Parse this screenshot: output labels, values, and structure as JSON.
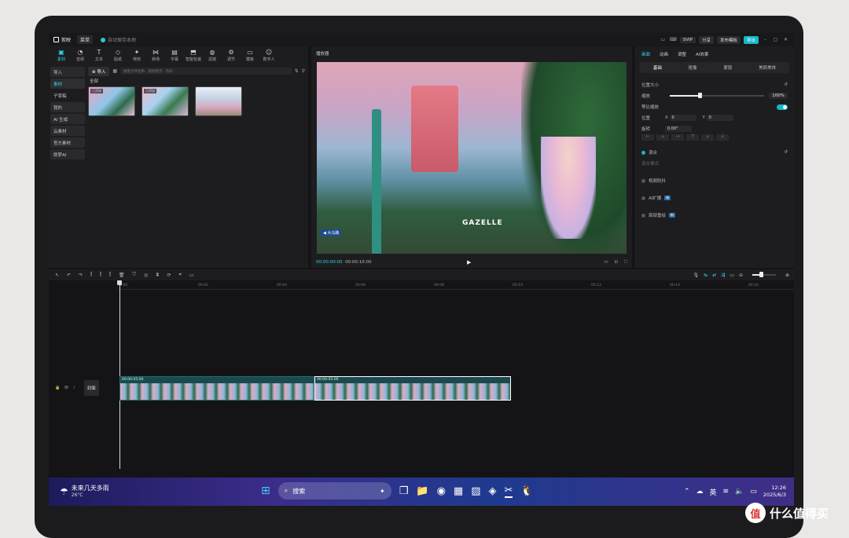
{
  "titlebar": {
    "app_name": "剪映",
    "menu": "菜单",
    "autosave": "自动保存本地",
    "svip": "SVIP",
    "share": "分享",
    "publish": "发布模板",
    "export": "导出"
  },
  "toolbar": {
    "tools": [
      {
        "label": "素材",
        "icon": "media-icon"
      },
      {
        "label": "音频",
        "icon": "audio-icon"
      },
      {
        "label": "文本",
        "icon": "text-icon"
      },
      {
        "label": "贴纸",
        "icon": "sticker-icon"
      },
      {
        "label": "特效",
        "icon": "effect-icon"
      },
      {
        "label": "转场",
        "icon": "transition-icon"
      },
      {
        "label": "字幕",
        "icon": "subtitle-icon"
      },
      {
        "label": "智能包装",
        "icon": "package-icon"
      },
      {
        "label": "滤镜",
        "icon": "filter-icon"
      },
      {
        "label": "调节",
        "icon": "adjust-icon"
      },
      {
        "label": "模板",
        "icon": "template-icon"
      },
      {
        "label": "数字人",
        "icon": "avatar-icon"
      }
    ]
  },
  "sidebar": {
    "items": [
      "导入",
      "素材",
      "子草稿",
      "我的",
      "AI 生成",
      "云素材",
      "官方素材",
      "即梦AI"
    ]
  },
  "media": {
    "import": "导入",
    "search_placeholder": "搜索文件名称、链接提示、色彩",
    "all": "全部",
    "thumbs": [
      {
        "tag": "已添加"
      },
      {
        "tag": "已添加"
      },
      {
        "tag": ""
      }
    ]
  },
  "player": {
    "title": "播放器",
    "timecode": "00:00:00:00",
    "duration": "00:00:10:00",
    "sign": "◀ 大马路",
    "logo": "GAZELLE"
  },
  "props": {
    "tabs": [
      "画面",
      "动画",
      "调整",
      "AI效果"
    ],
    "subtabs": [
      "基础",
      "抠像",
      "蒙版",
      "美颜美体"
    ],
    "pos_size": "位置大小",
    "scale": "缩放",
    "scale_val": "100%",
    "ratio": "等比缩放",
    "position": "位置",
    "x_label": "X",
    "x_val": "0",
    "y_label": "Y",
    "y_val": "0",
    "rotate": "旋转",
    "rotate_val": "0.00°",
    "mix": "混合",
    "mix_mode": "混合模式",
    "stabilize": "视频防抖",
    "ai_expand": "AI扩展",
    "ai_badge": "新",
    "local_redraw": "局部重绘",
    "redraw_badge": "新"
  },
  "timeline": {
    "ruler": [
      "0:00",
      "00:02",
      "00:04",
      "00:06",
      "00:08",
      "00:10",
      "00:12",
      "00:14",
      "00:16"
    ],
    "cover": "封面",
    "clip1_label": "00:00:05:00",
    "clip2_label": "00:00:05:00"
  },
  "taskbar": {
    "weather_title": "未来几天多雨",
    "weather_temp": "26°C",
    "weather_badge": "1",
    "search": "搜索",
    "lang": "英",
    "time": "12:26",
    "date": "2025/6/3"
  },
  "watermark": {
    "text": "什么值得买",
    "logo_char": "值"
  }
}
